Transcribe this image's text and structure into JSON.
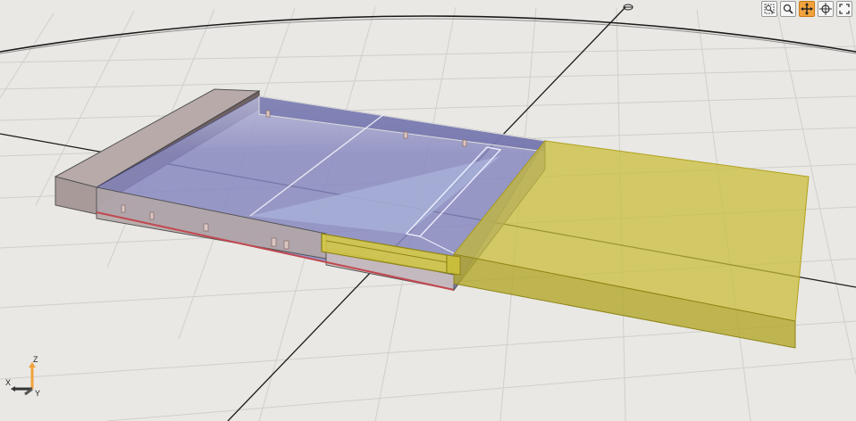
{
  "viewport": {
    "background": "#e9e8e4",
    "grid_color": "#cfcfcb",
    "axis_line_color": "#1a1a1a"
  },
  "toolbar": {
    "buttons": [
      {
        "name": "zoom-window",
        "icon": "zoom-window-icon",
        "active": false
      },
      {
        "name": "zoom",
        "icon": "zoom-icon",
        "active": false
      },
      {
        "name": "pan",
        "icon": "pan-arrows-icon",
        "active": true
      },
      {
        "name": "orbit",
        "icon": "orbit-icon",
        "active": false
      },
      {
        "name": "zoom-extents",
        "icon": "zoom-extents-icon",
        "active": false
      }
    ],
    "active_color": "#f2a23c"
  },
  "axis_triad": {
    "z_label": "Z",
    "x_label": "X",
    "y_label": "Y",
    "z_color": "#f2a23c"
  },
  "model": {
    "roof_surface_color": "#7f80b8",
    "wall_color": "#a59a9a",
    "selected_color": "#c9bd3c"
  }
}
